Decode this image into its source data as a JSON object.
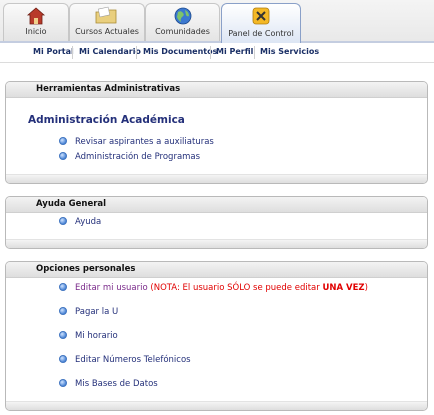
{
  "tabs": [
    {
      "label": "Inicio",
      "icon": "house-icon"
    },
    {
      "label": "Cursos Actuales",
      "icon": "folder-icon"
    },
    {
      "label": "Comunidades",
      "icon": "globe-icon"
    },
    {
      "label": "Panel de Control",
      "icon": "tools-icon",
      "active": true
    }
  ],
  "subnav": [
    "Mi Portal",
    "Mi Calendario",
    "Mis Documentos",
    "Mi Perfil",
    "Mis Servicios"
  ],
  "admin": {
    "title": "Herramientas Administrativas",
    "heading": "Administración Académica",
    "links": [
      "Revisar aspirantes a auxiliaturas",
      "Administración de Programas"
    ]
  },
  "help": {
    "title": "Ayuda General",
    "links": [
      "Ayuda"
    ]
  },
  "personal": {
    "title": "Opciones personales",
    "edit_user": "Editar mi usuario",
    "note_prefix": " (NOTA: El usuario SÓLO se puede editar ",
    "note_emph": "UNA VEZ",
    "note_suffix": ")",
    "links": [
      "Pagar la U",
      "Mi horario",
      "Editar Números Telefónicos",
      "Mis Bases de Datos"
    ]
  },
  "colors": {
    "link": "#24307a",
    "visited": "#7a2a8a",
    "note": "#e10000"
  }
}
